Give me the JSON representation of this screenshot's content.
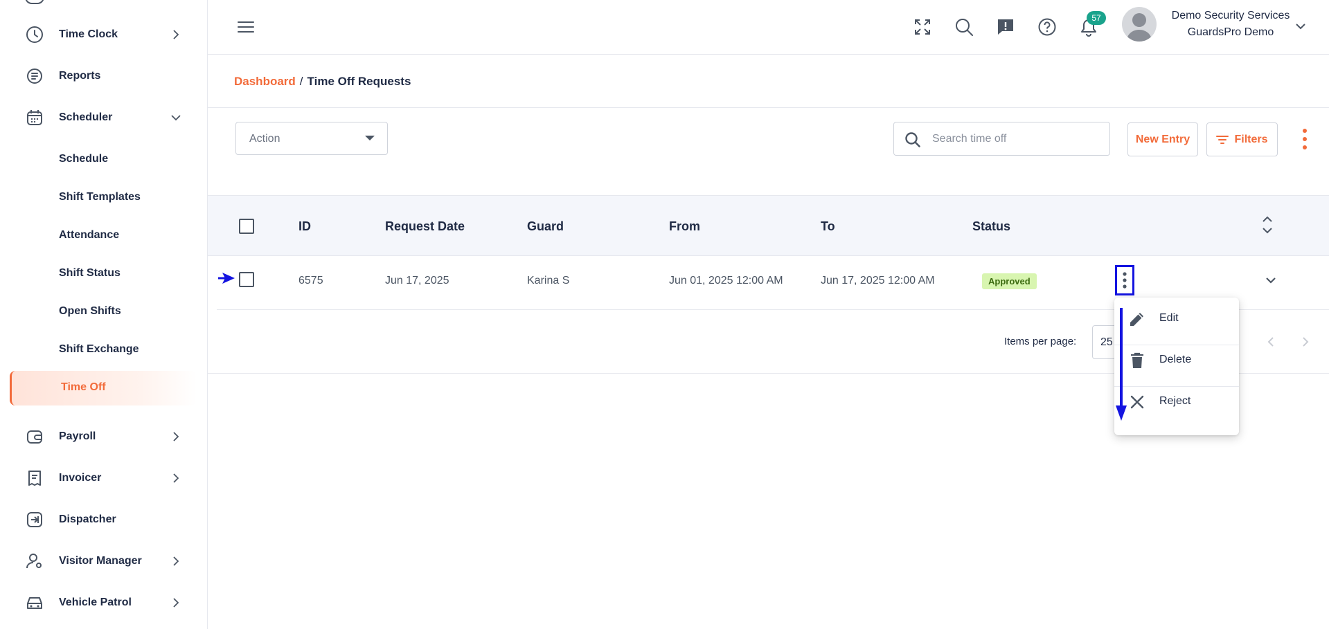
{
  "sidebar": {
    "items": [
      {
        "label": "Time Clock",
        "icon": "clock-icon",
        "expandable": true
      },
      {
        "label": "Reports",
        "icon": "report-icon",
        "expandable": false
      },
      {
        "label": "Scheduler",
        "icon": "calendar-icon",
        "expandable": true,
        "expanded": true
      },
      {
        "label": "Payroll",
        "icon": "wallet-icon",
        "expandable": true
      },
      {
        "label": "Invoicer",
        "icon": "receipt-icon",
        "expandable": true
      },
      {
        "label": "Dispatcher",
        "icon": "dispatch-icon",
        "expandable": false
      },
      {
        "label": "Visitor Manager",
        "icon": "visitor-icon",
        "expandable": true
      },
      {
        "label": "Vehicle Patrol",
        "icon": "car-icon",
        "expandable": true
      }
    ],
    "scheduler_sub": [
      "Schedule",
      "Shift Templates",
      "Attendance",
      "Shift Status",
      "Open Shifts",
      "Shift Exchange",
      "Time Off"
    ],
    "active_sub": "Time Off"
  },
  "header": {
    "notification_count": "57",
    "org_name": "Demo Security Services",
    "user_name": "GuardsPro Demo",
    "icons": [
      "expand-icon",
      "search-icon",
      "feedback-icon",
      "help-icon",
      "bell-icon"
    ]
  },
  "breadcrumb": {
    "link": "Dashboard",
    "separator": "/",
    "current": "Time Off Requests"
  },
  "toolbar": {
    "action_placeholder": "Action",
    "search_placeholder": "Search time off",
    "new_entry_label": "New Entry",
    "filters_label": "Filters"
  },
  "table": {
    "columns": [
      "ID",
      "Request Date",
      "Guard",
      "From",
      "To",
      "Status"
    ],
    "rows": [
      {
        "id": "6575",
        "request_date": "Jun 17, 2025",
        "guard": "Karina S",
        "from": "Jun 01, 2025 12:00 AM",
        "to": "Jun 17, 2025 12:00 AM",
        "status": "Approved"
      }
    ]
  },
  "pagination": {
    "items_per_page_label": "Items per page:",
    "items_per_page_value": "25"
  },
  "row_menu": {
    "items": [
      {
        "label": "Edit",
        "icon": "pencil-icon"
      },
      {
        "label": "Delete",
        "icon": "trash-icon"
      },
      {
        "label": "Reject",
        "icon": "close-icon"
      }
    ]
  },
  "colors": {
    "accent": "#f26b3a",
    "badge_bg": "#d8f5b0",
    "notif_badge": "#1aa38c",
    "annotation_blue": "#1414e0"
  }
}
